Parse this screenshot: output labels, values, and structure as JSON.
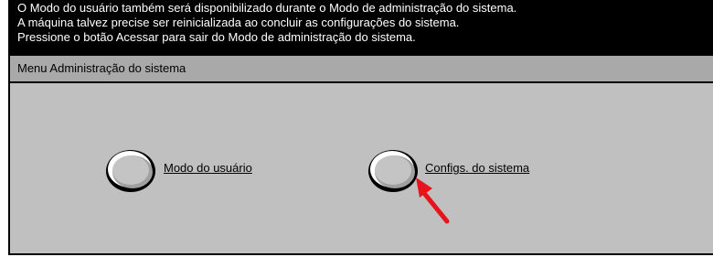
{
  "messages": [
    "O Modo do usuário também será disponibilizado durante o Modo de administração do sistema.",
    "A máquina talvez precise ser reinicializada ao concluir as configurações do sistema.",
    "Pressione o botão Acessar para sair do Modo de administração do sistema."
  ],
  "menu": {
    "title": "Menu Administração do sistema",
    "options": [
      {
        "label": "Modo do usuário"
      },
      {
        "label": "Configs. do sistema"
      }
    ]
  },
  "colors": {
    "screen_background": "#c0c0c0",
    "header_background": "#a9a9a9",
    "message_background": "#000000",
    "arrow": "#e8141b"
  }
}
